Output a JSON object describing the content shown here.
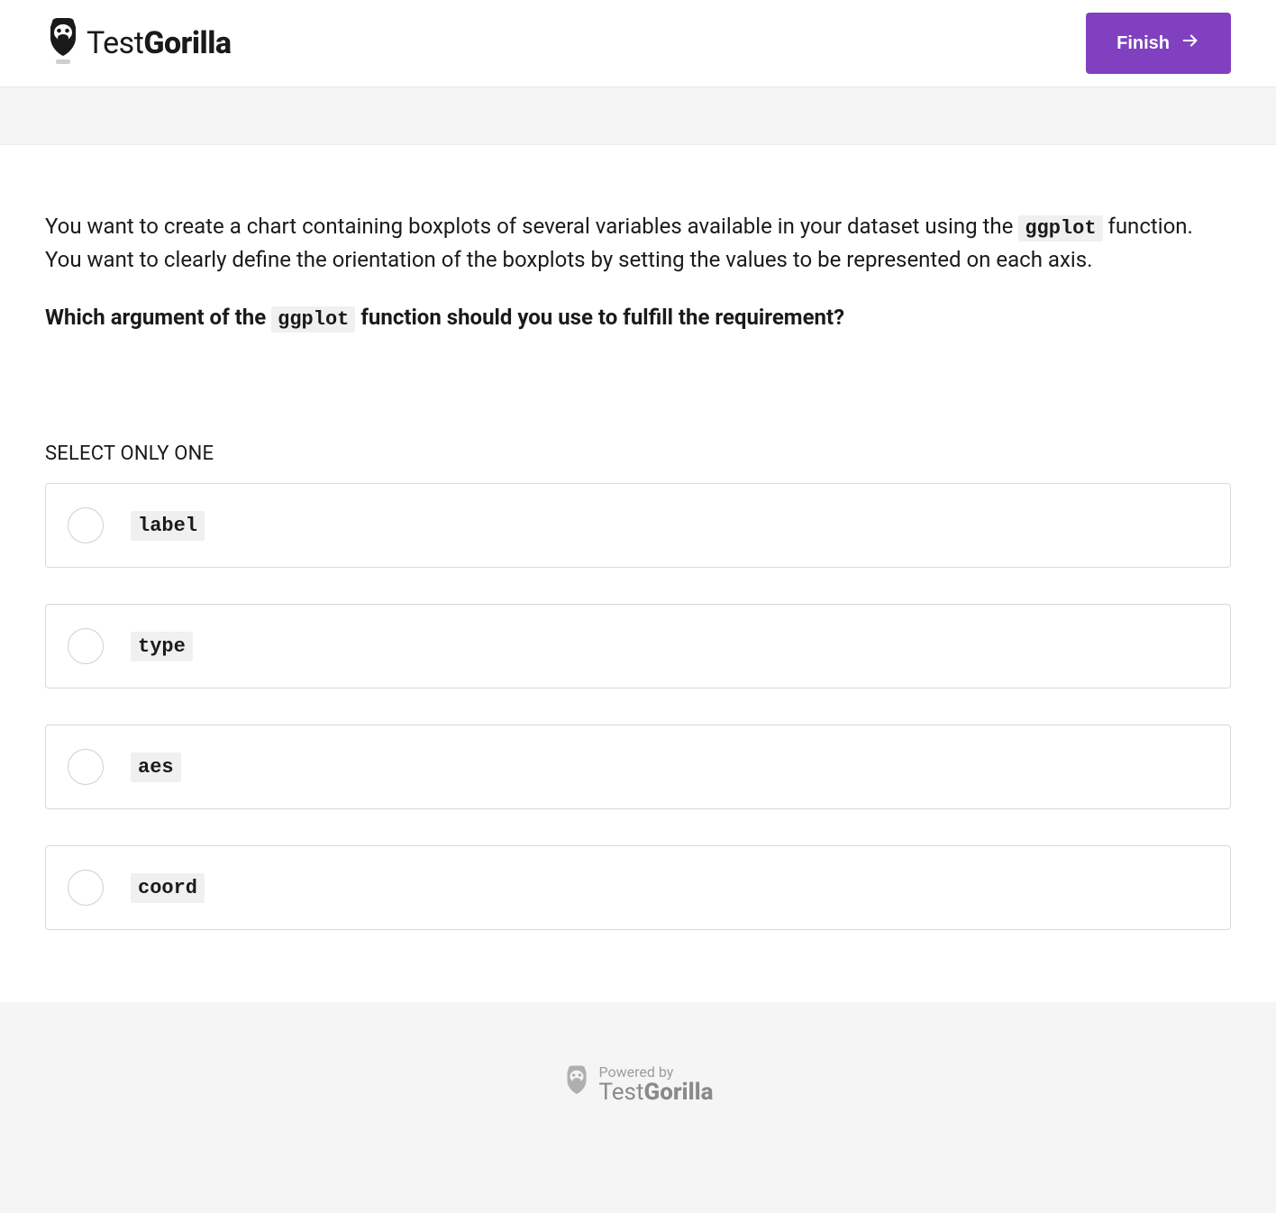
{
  "header": {
    "brand_prefix": "Test",
    "brand_bold": "Gorilla",
    "finish_label": "Finish"
  },
  "question": {
    "prompt_part1": "You want to create a chart containing boxplots of several variables available in your dataset using the ",
    "prompt_code1": "ggplot",
    "prompt_part2": " function. You want to clearly define the orientation of the boxplots by setting the values to be represented on each axis.",
    "bold_part1": "Which argument of the ",
    "bold_code": "ggplot",
    "bold_part2": " function should you use to fulfill the requirement?"
  },
  "select_label": "SELECT ONLY ONE",
  "options": [
    {
      "code": "label"
    },
    {
      "code": "type"
    },
    {
      "code": "aes"
    },
    {
      "code": "coord"
    }
  ],
  "footer": {
    "powered_by": "Powered by",
    "brand_prefix": "Test",
    "brand_bold": "Gorilla"
  }
}
